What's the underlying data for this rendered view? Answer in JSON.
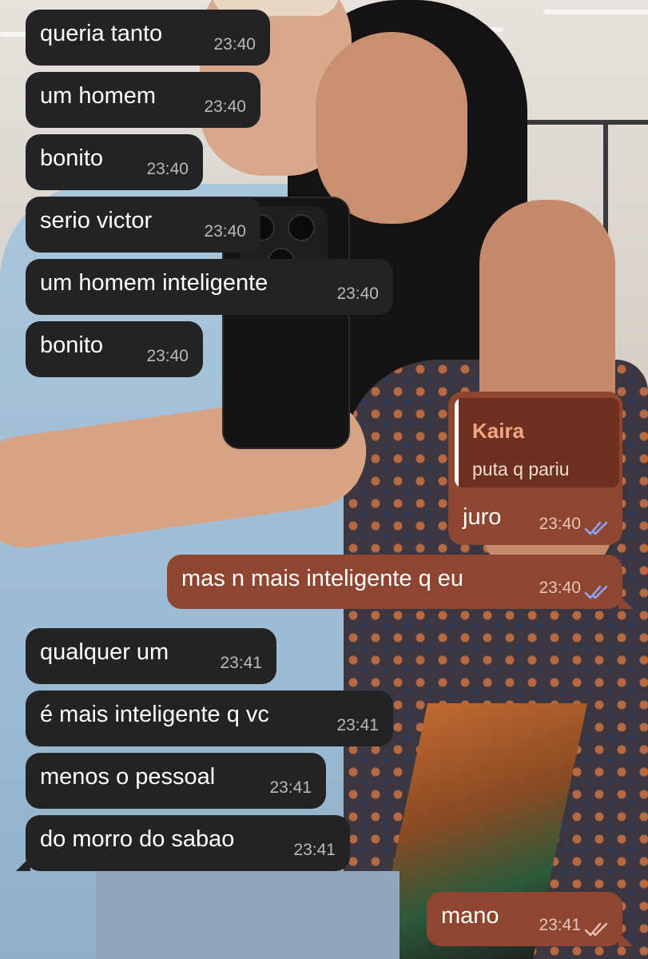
{
  "colors": {
    "incoming_bubble": "#232325",
    "outgoing_bubble": "#8f4630",
    "reply_name": "#f4a582",
    "read_check": "#8fa8ff",
    "sent_check": "#e6c6b8"
  },
  "messages": [
    {
      "direction": "in",
      "text": "queria tanto",
      "time": "23:40"
    },
    {
      "direction": "in",
      "text": "um homem",
      "time": "23:40"
    },
    {
      "direction": "in",
      "text": "bonito",
      "time": "23:40"
    },
    {
      "direction": "in",
      "text": "serio victor",
      "time": "23:40"
    },
    {
      "direction": "in",
      "text": "um homem inteligente",
      "time": "23:40"
    },
    {
      "direction": "in",
      "text": "bonito",
      "time": "23:40"
    },
    {
      "direction": "out",
      "text": "juro",
      "time": "23:40",
      "status": "read",
      "reply_to": {
        "name": "Kaira",
        "text": "puta q pariu"
      }
    },
    {
      "direction": "out",
      "text": "mas n mais inteligente q eu",
      "time": "23:40",
      "status": "read"
    },
    {
      "direction": "in",
      "text": "qualquer um",
      "time": "23:41"
    },
    {
      "direction": "in",
      "text": "é mais inteligente q vc",
      "time": "23:41"
    },
    {
      "direction": "in",
      "text": "menos o pessoal",
      "time": "23:41"
    },
    {
      "direction": "in",
      "text": "do morro do sabao",
      "time": "23:41"
    },
    {
      "direction": "out",
      "text": "mano",
      "time": "23:41",
      "status": "delivered"
    }
  ]
}
